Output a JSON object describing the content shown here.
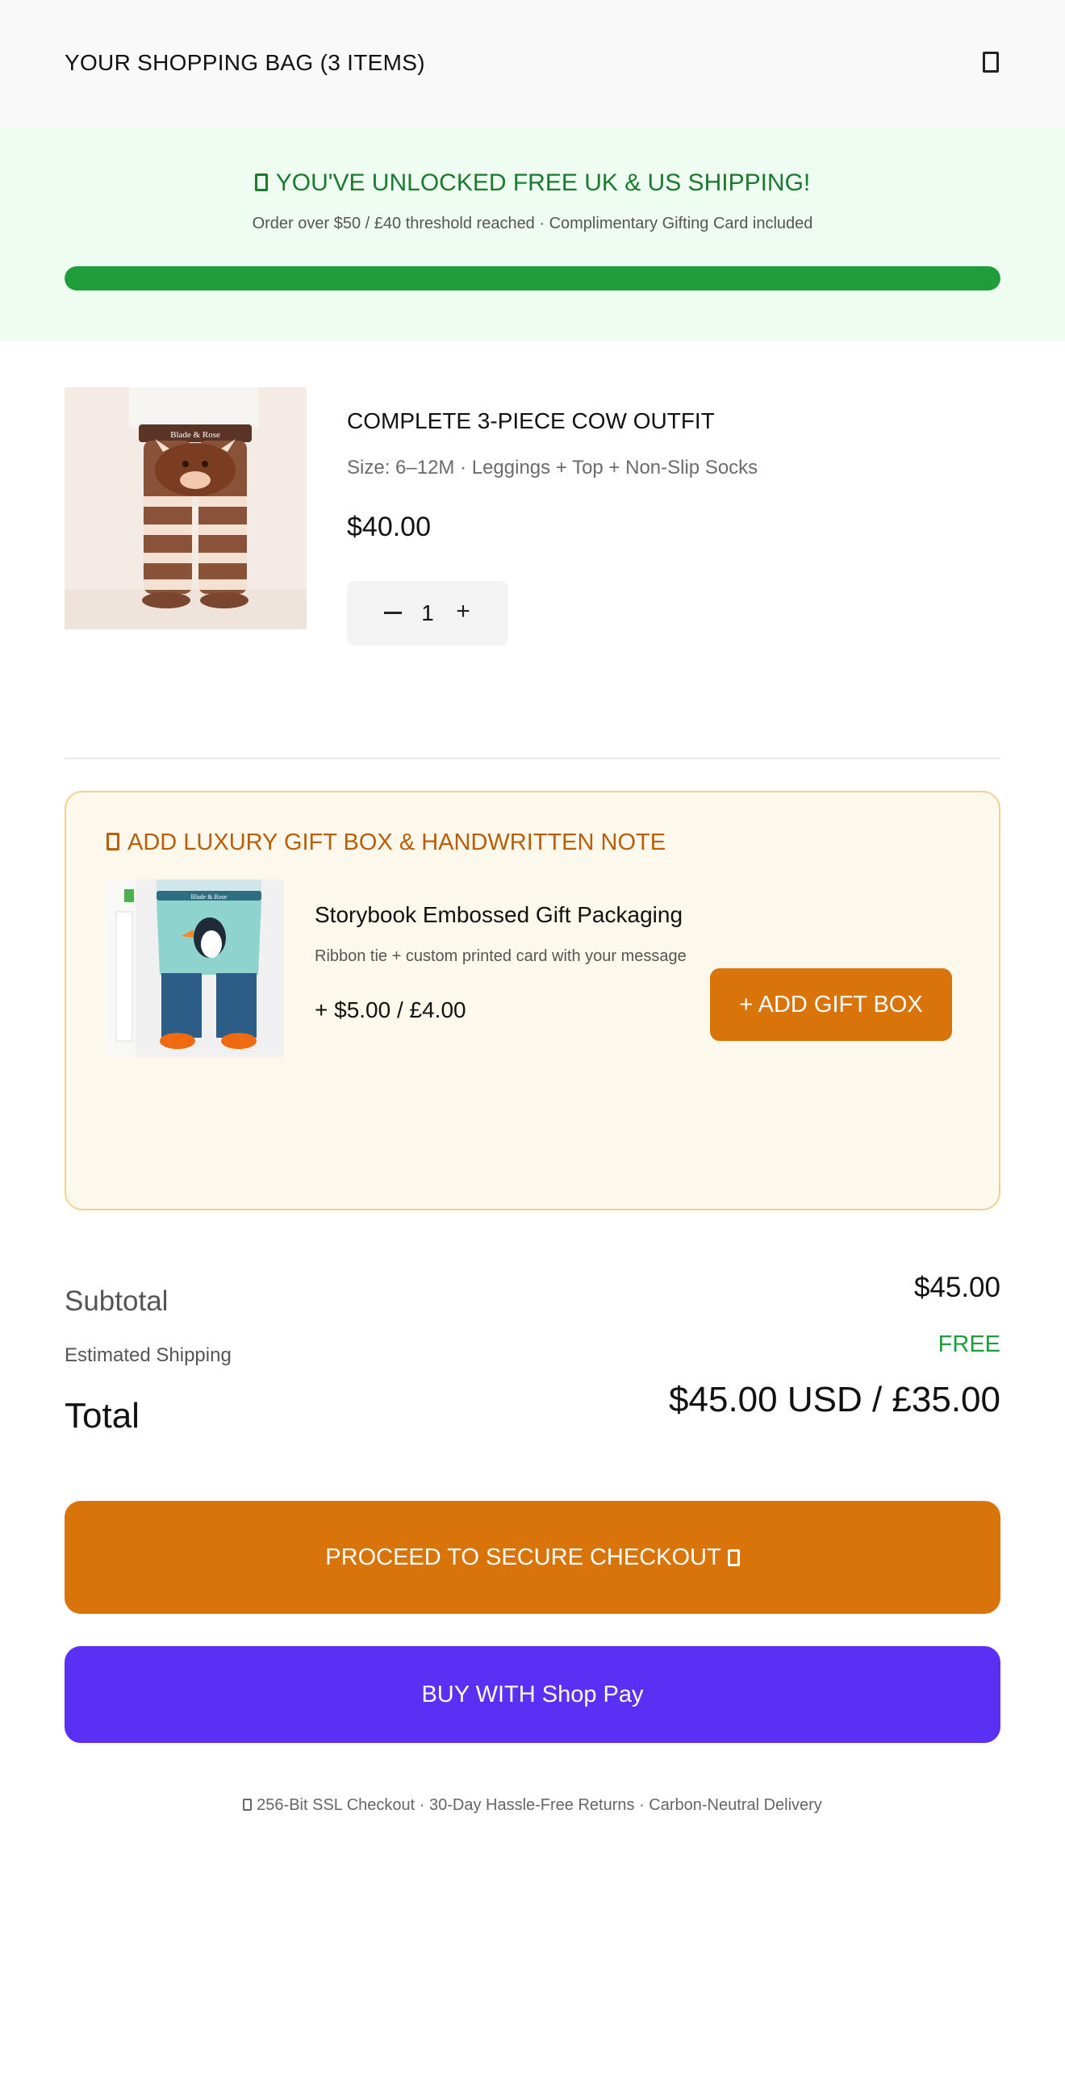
{
  "header": {
    "title": "YOUR SHOPPING BAG (3 ITEMS)",
    "icon": "bag-icon"
  },
  "shipping_banner": {
    "title": "YOU'VE UNLOCKED FREE UK & US SHIPPING!",
    "subtitle": "Order over $50 / £40 threshold reached · Complimentary Gifting Card included",
    "progress": 1.0,
    "color": "#1f9d3a"
  },
  "cart_item": {
    "name": "COMPLETE 3-PIECE COW OUTFIT",
    "meta": "Size: 6–12M · Leggings + Top + Non-Slip Socks",
    "price": "$40.00",
    "quantity": "1",
    "image_brand": "Blade & Rose"
  },
  "gift_upsell": {
    "title": "ADD LUXURY GIFT BOX & HANDWRITTEN NOTE",
    "name": "Storybook Embossed Gift Packaging",
    "description": "Ribbon tie + custom printed card with your message",
    "price": "+ $5.00 / £4.00",
    "button_label": "+ ADD GIFT BOX",
    "image_brand": "Blade & Rose",
    "accent": "#d9740a"
  },
  "summary": {
    "subtotal_label": "Subtotal",
    "subtotal_value": "$45.00",
    "shipping_label": "Estimated Shipping",
    "shipping_value": "FREE",
    "total_label": "Total",
    "total_value": "$45.00 USD / £35.00"
  },
  "actions": {
    "checkout_label": "PROCEED TO SECURE CHECKOUT",
    "shoppay_label": "BUY WITH Shop Pay"
  },
  "footer": {
    "trust_text": "256-Bit SSL Checkout · 30-Day Hassle-Free Returns · Carbon-Neutral Delivery"
  }
}
